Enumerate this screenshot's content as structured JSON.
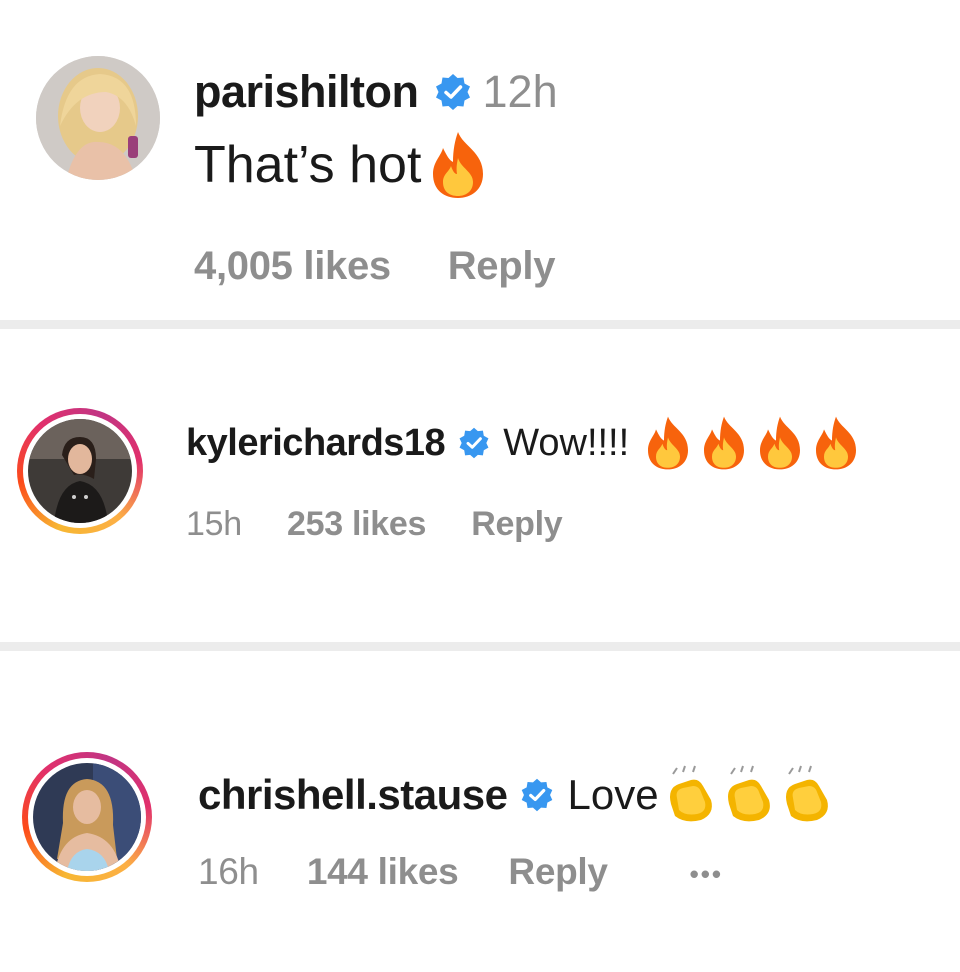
{
  "comments": [
    {
      "username": "parishilton",
      "time": "12h",
      "text": "That’s hot",
      "likes": "4,005 likes",
      "reply": "Reply",
      "emoji": "fire-icon",
      "avatar": "paris-avatar"
    },
    {
      "username": "kylerichards18",
      "time": "15h",
      "text": "Wow!!!!",
      "likes": "253 likes",
      "reply": "Reply",
      "emoji": "fire-icon",
      "avatar": "kyle-avatar"
    },
    {
      "username": "chrishell.stause",
      "time": "16h",
      "text": "Love",
      "likes": "144 likes",
      "reply": "Reply",
      "more": "•••",
      "emoji": "clapping-hands-icon",
      "avatar": "chrishell-avatar"
    }
  ],
  "colors": {
    "verified": "#3897f0",
    "meta_text": "#8e8e8e",
    "divider": "#ececec",
    "fire_outer": "#f7630c",
    "fire_inner": "#ffc83d",
    "clap": "#f4b400"
  }
}
